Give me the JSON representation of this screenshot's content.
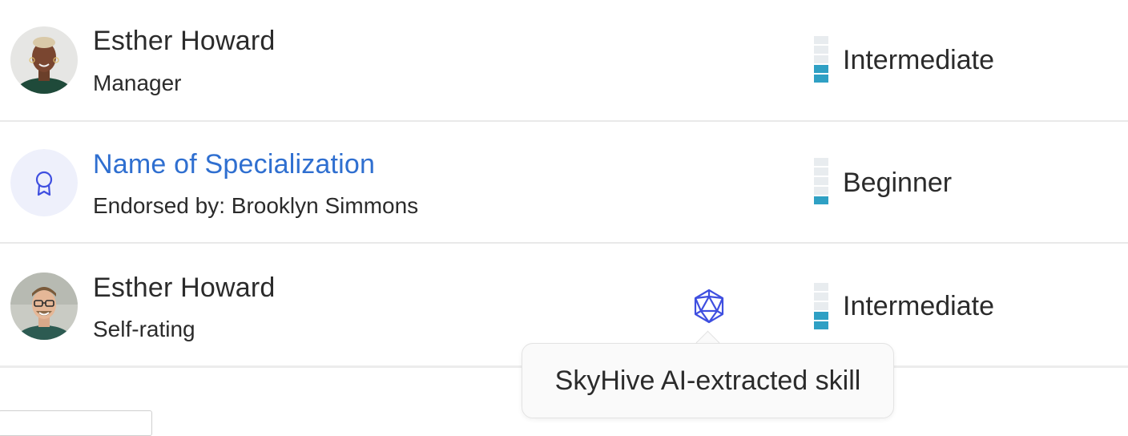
{
  "endorsements": [
    {
      "name": "Esther Howard",
      "subtitle": "Manager",
      "level": "Intermediate",
      "level_filled": 2,
      "level_total": 5,
      "avatar": "woman-photo-avatar"
    },
    {
      "name": "Name of Specialization",
      "subtitle": "Endorsed by: Brooklyn Simmons",
      "level": "Beginner",
      "level_filled": 1,
      "level_total": 5,
      "avatar": "award-ribbon-icon"
    },
    {
      "name": "Esther Howard",
      "subtitle": "Self-rating",
      "level": "Intermediate",
      "level_filled": 2,
      "level_total": 5,
      "avatar": "man-photo-avatar",
      "ai_icon": "skyhive-ai-icon"
    }
  ],
  "tooltip": {
    "text": "SkyHive AI-extracted skill"
  },
  "colors": {
    "link": "#2f6fd0",
    "level_on": "#2fa0c4",
    "level_off": "#e8ecef",
    "ai_icon": "#3f4fe0",
    "award_bg": "#eef0fb"
  }
}
